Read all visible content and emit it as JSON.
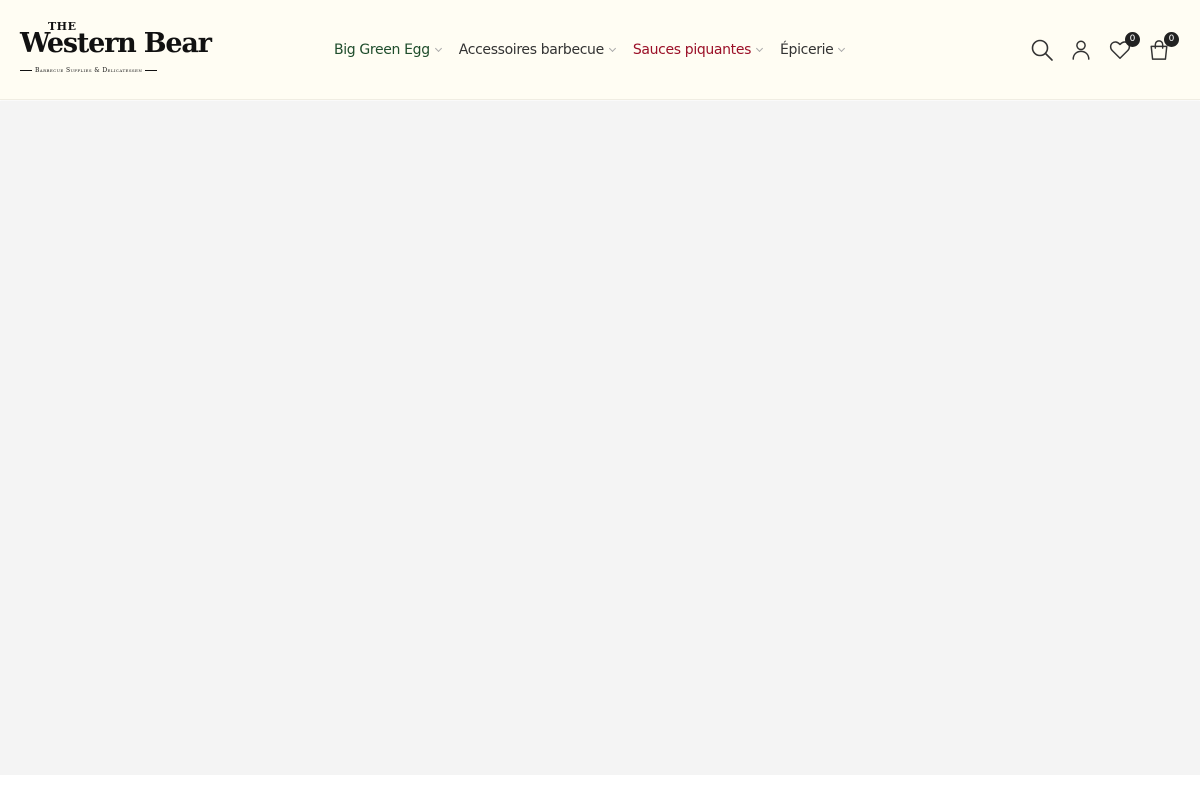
{
  "brand": {
    "the": "THE",
    "name": "Western Bear",
    "tagline": "Barbecue Supplies & Delicatessen"
  },
  "nav": {
    "items": [
      {
        "label": "Big Green Egg",
        "color": "#1f4d2c"
      },
      {
        "label": "Accessoires barbecue",
        "color": "#333333"
      },
      {
        "label": "Sauces piquantes",
        "color": "#9b1028"
      },
      {
        "label": "Épicerie",
        "color": "#333333"
      }
    ]
  },
  "actions": {
    "search_icon": "search-icon",
    "account_icon": "user-icon",
    "wishlist_icon": "heart-icon",
    "wishlist_count": "0",
    "cart_icon": "shopping-bag-icon",
    "cart_count": "0"
  },
  "colors": {
    "header_bg": "#fffdf3",
    "content_bg": "#f4f4f4",
    "accent_green": "#1f4d2c",
    "accent_red": "#9b1028"
  }
}
